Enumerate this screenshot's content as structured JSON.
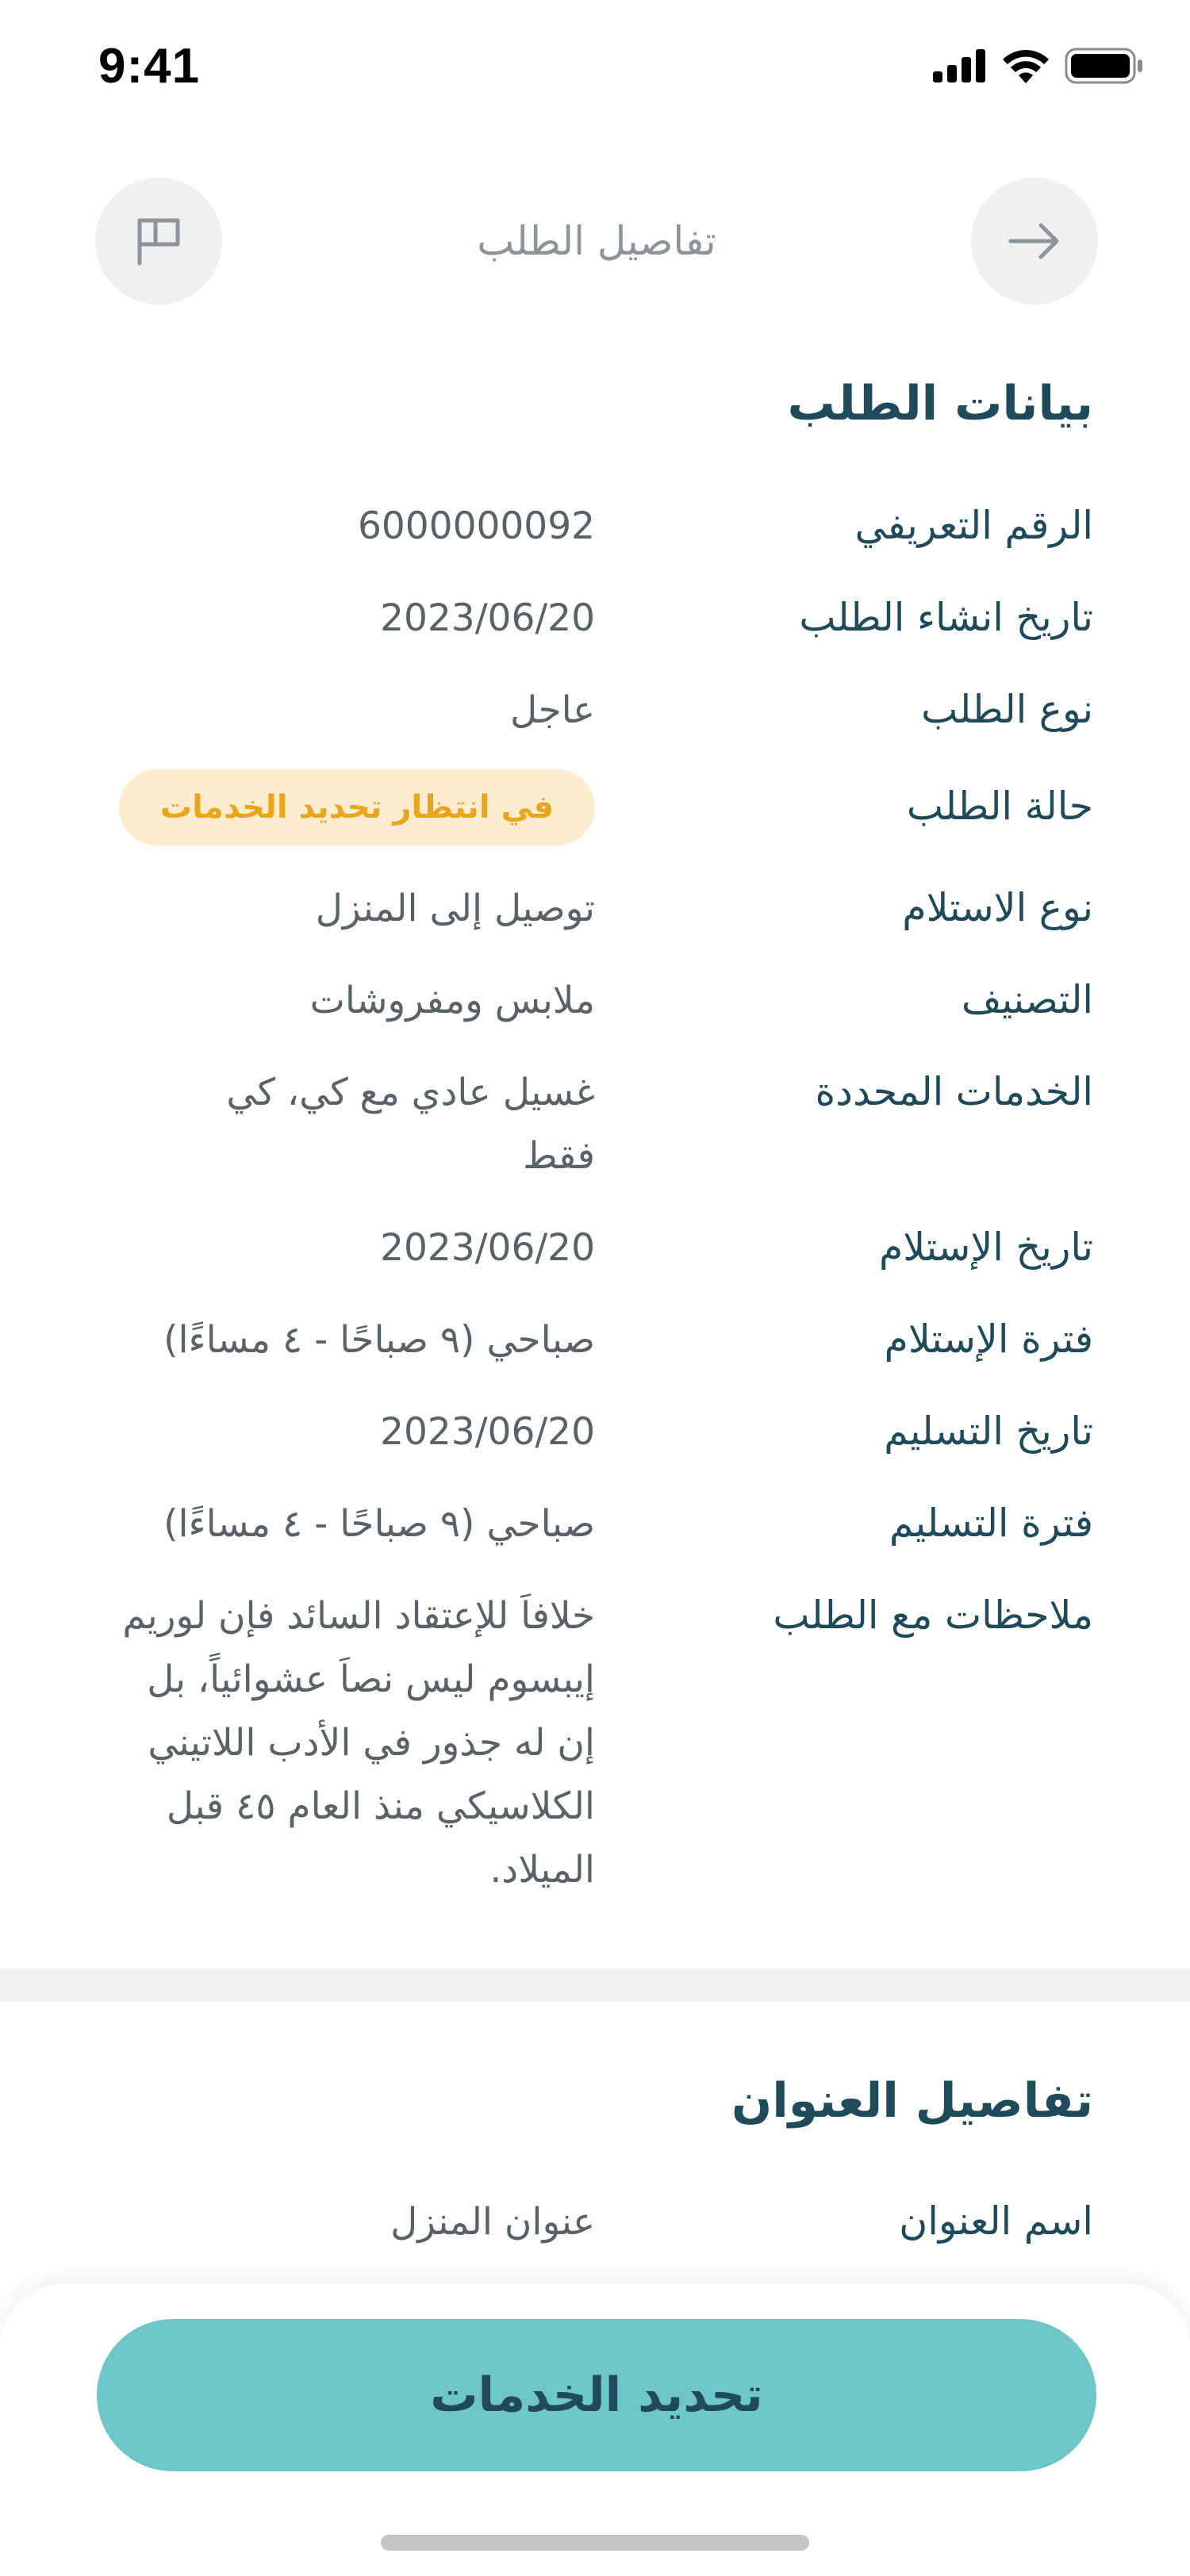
{
  "status_bar": {
    "time": "9:41"
  },
  "header": {
    "title": "تفاصيل الطلب",
    "back_icon": "arrow-right-icon",
    "flag_icon": "flag-icon"
  },
  "order_section": {
    "title": "بيانات الطلب",
    "rows": [
      {
        "label": "الرقم التعريفي",
        "value": "6000000092"
      },
      {
        "label": "تاريخ انشاء الطلب",
        "value": "2023/06/20"
      },
      {
        "label": "نوع الطلب",
        "value": "عاجل"
      },
      {
        "label": "حالة الطلب",
        "value": "في انتظار تحديد الخدمات"
      },
      {
        "label": "نوع الاستلام",
        "value": "توصيل إلى المنزل"
      },
      {
        "label": "التصنيف",
        "value": "ملابس ومفروشات"
      },
      {
        "label": "الخدمات المحددة",
        "value": "غسيل عادي مع كي، كي فقط"
      },
      {
        "label": "تاريخ الإستلام",
        "value": "2023/06/20"
      },
      {
        "label": "فترة الإستلام",
        "value": "صباحي (٩ صباحًا - ٤ مساءًا)"
      },
      {
        "label": "تاريخ التسليم",
        "value": "2023/06/20"
      },
      {
        "label": "فترة التسليم",
        "value": "صباحي (٩ صباحًا - ٤ مساءًا)"
      },
      {
        "label": "ملاحظات مع الطلب",
        "value": "خلافاَ للإعتقاد السائد فإن لوريم إيبسوم ليس نصاَ عشوائياً، بل إن له جذور في الأدب اللاتيني الكلاسيكي منذ العام ٤٥ قبل الميلاد."
      }
    ],
    "status_color": "#e8a51f",
    "status_bg": "#fdeccd"
  },
  "address_section": {
    "title": "تفاصيل العنوان",
    "rows": [
      {
        "label": "اسم العنوان",
        "value": "عنوان المنزل"
      }
    ]
  },
  "footer": {
    "primary_button": "تحديد الخدمات",
    "button_color": "#6fc6c8"
  }
}
